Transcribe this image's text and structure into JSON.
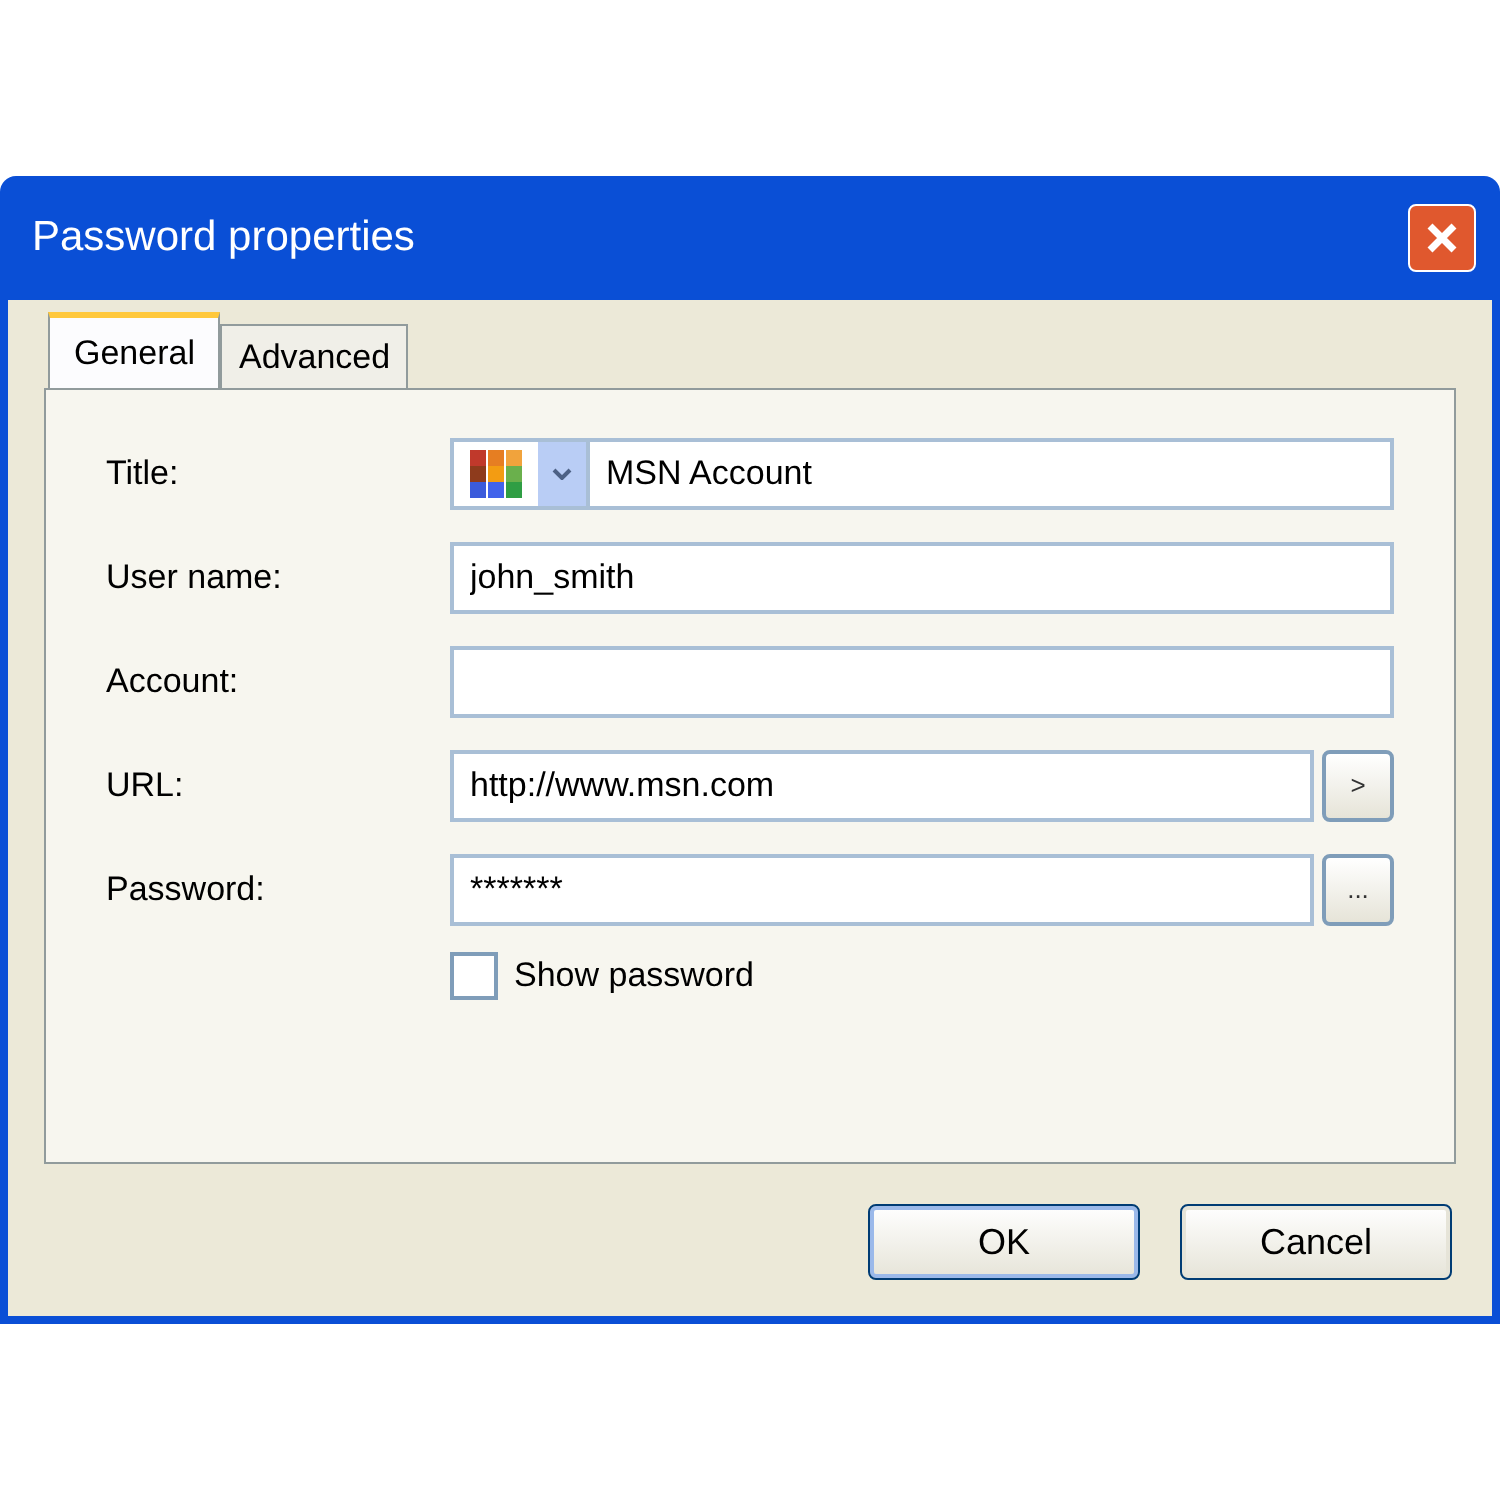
{
  "window": {
    "title": "Password properties"
  },
  "tabs": [
    {
      "label": "General",
      "selected": true
    },
    {
      "label": "Advanced",
      "selected": false
    }
  ],
  "fields": [
    {
      "kind": "icon_combo",
      "label": "Title:",
      "value": "MSN Account"
    },
    {
      "kind": "text",
      "label": "User name:",
      "value": "john_smith"
    },
    {
      "kind": "text",
      "label": "Account:"
    },
    {
      "kind": "with_button",
      "label": "URL:",
      "value": "http://www.msn.com",
      "button": ">"
    },
    {
      "kind": "with_button",
      "label": "Password:",
      "value": "*******",
      "button": "..."
    }
  ],
  "show_password": {
    "label": "Show password",
    "checked": false
  },
  "buttons": [
    {
      "label": "OK",
      "default": true
    },
    {
      "label": "Cancel",
      "default": false
    }
  ]
}
